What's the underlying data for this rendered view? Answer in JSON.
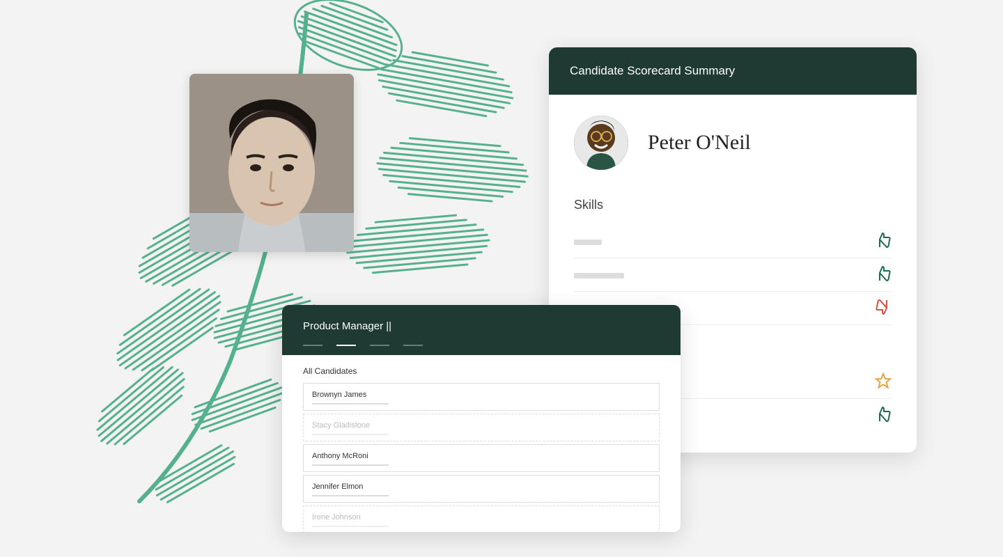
{
  "colors": {
    "panel_header": "#1e3a32",
    "thumbs_up": "#1e6b52",
    "thumbs_down": "#d94e3f",
    "star": "#e8a23d",
    "fern": "#2fa076"
  },
  "scorecard": {
    "title": "Candidate Scorecard Summary",
    "candidate_name": "Peter O'Neil",
    "skills_label": "Skills",
    "rows": [
      {
        "rating": "thumbs_up"
      },
      {
        "rating": "thumbs_up"
      },
      {
        "rating": "thumbs_down"
      },
      {
        "rating": "spacer"
      },
      {
        "rating": "star"
      },
      {
        "rating": "thumbs_up"
      }
    ]
  },
  "job": {
    "title": "Product Manager ||",
    "all_candidates_label": "All Candidates",
    "tabs": [
      {
        "active": false
      },
      {
        "active": true
      },
      {
        "active": false
      },
      {
        "active": false
      }
    ],
    "candidates": [
      {
        "name": "Brownyn James",
        "active": true
      },
      {
        "name": "Stacy Gladistone",
        "active": false
      },
      {
        "name": "Anthony McRoni",
        "active": true
      },
      {
        "name": "Jennifer Elmon",
        "active": true
      },
      {
        "name": "Irene Johnson",
        "active": false
      }
    ]
  }
}
